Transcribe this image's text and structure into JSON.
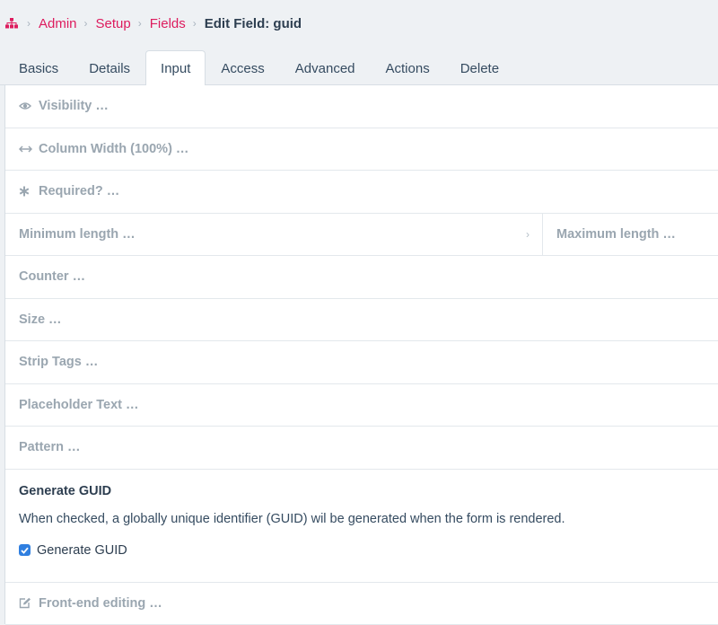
{
  "breadcrumb": {
    "items": [
      "Admin",
      "Setup",
      "Fields"
    ],
    "current": "Edit Field: guid"
  },
  "tabs": [
    "Basics",
    "Details",
    "Input",
    "Access",
    "Advanced",
    "Actions",
    "Delete"
  ],
  "active_tab": "Input",
  "rows": {
    "visibility": "Visibility …",
    "column_width": "Column Width (100%) …",
    "required": "Required? …",
    "min_length": "Minimum length …",
    "max_length": "Maximum length …",
    "counter": "Counter …",
    "size": "Size …",
    "strip_tags": "Strip Tags …",
    "placeholder": "Placeholder Text …",
    "pattern": "Pattern …",
    "front_end": "Front-end editing …"
  },
  "guid": {
    "title": "Generate GUID",
    "description": "When checked, a globally unique identifier (GUID) wil be generated when the form is rendered.",
    "checkbox_label": "Generate GUID",
    "checked": true
  },
  "colors": {
    "accent": "#dd1c5e",
    "checkbox": "#2f7fe0"
  }
}
